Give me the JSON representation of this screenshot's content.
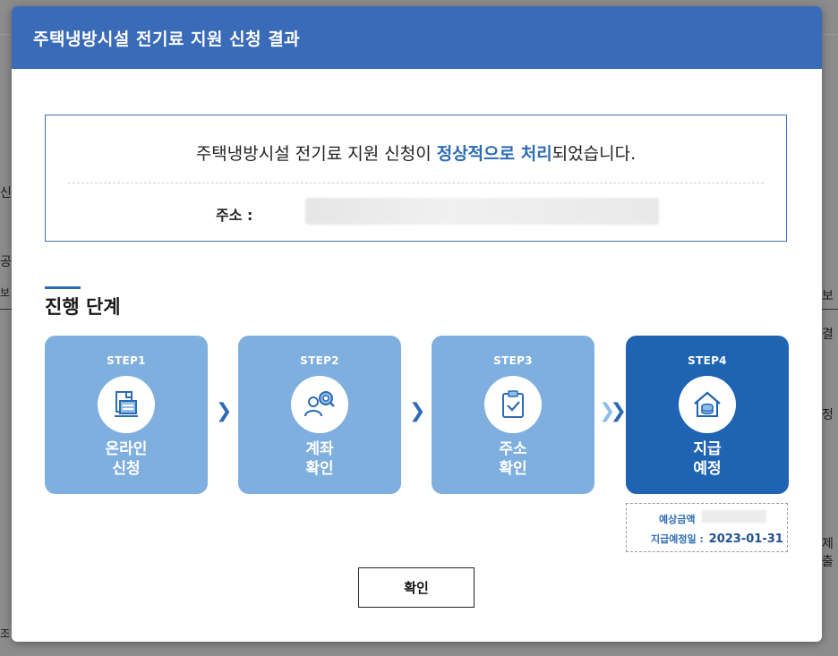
{
  "modal": {
    "title": "주택냉방시설 전기료 지원 신청 결과",
    "result_message": {
      "prefix": "주택냉방시설 전기료 지원 신청이 ",
      "highlight": "정상적으로 처리",
      "suffix": "되었습니다."
    },
    "address_label": "주소 :",
    "section_title": "진행 단계",
    "steps": [
      {
        "label": "STEP1",
        "name_line1": "온라인",
        "name_line2": "신청",
        "icon": "document-icon"
      },
      {
        "label": "STEP2",
        "name_line1": "계좌",
        "name_line2": "확인",
        "icon": "user-search-icon"
      },
      {
        "label": "STEP3",
        "name_line1": "주소",
        "name_line2": "확인",
        "icon": "clipboard-check-icon"
      },
      {
        "label": "STEP4",
        "name_line1": "지급",
        "name_line2": "예정",
        "icon": "house-coins-icon"
      }
    ],
    "payment": {
      "amount_label": "예상금액",
      "date_label": "지급예정일 :",
      "date_value": "2023-01-31"
    },
    "confirm_button": "확인"
  },
  "background": {
    "fragments": [
      "신청",
      "공",
      "보",
      "보",
      "결",
      "정",
      "제출",
      "조"
    ]
  },
  "colors": {
    "header": "#3a6bb8",
    "accent": "#2d6bb5",
    "step_inactive": "#7fafdf",
    "step_active": "#1f63b3"
  }
}
